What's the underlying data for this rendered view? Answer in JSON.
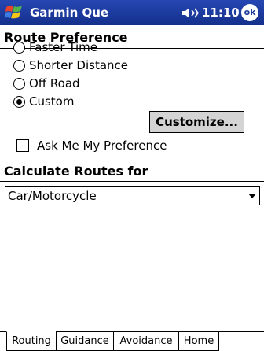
{
  "titlebar": {
    "app_title": "Garmin Que",
    "time": "11:10",
    "ok_label": "ok",
    "color": "#1d3a9a"
  },
  "route_preference": {
    "heading": "Route Preference",
    "options": [
      {
        "label": "Faster Time",
        "checked": false
      },
      {
        "label": "Shorter Distance",
        "checked": false
      },
      {
        "label": "Off Road",
        "checked": false
      },
      {
        "label": "Custom",
        "checked": true
      }
    ],
    "customize_label": "Customize...",
    "ask_label": "Ask Me My Preference",
    "ask_checked": false
  },
  "calculate": {
    "heading": "Calculate Routes for",
    "selected": "Car/Motorcycle"
  },
  "tabs": [
    {
      "label": "Routing",
      "active": true
    },
    {
      "label": "Guidance",
      "active": false
    },
    {
      "label": "Avoidance",
      "active": false
    },
    {
      "label": "Home",
      "active": false
    }
  ]
}
